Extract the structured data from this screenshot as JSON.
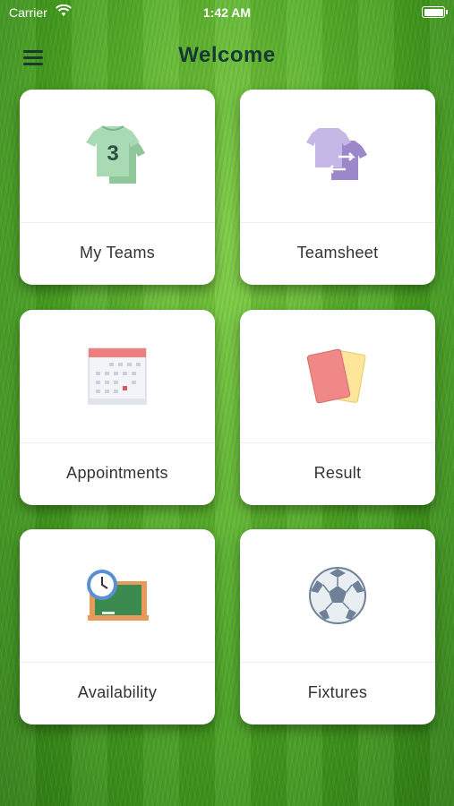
{
  "status_bar": {
    "carrier": "Carrier",
    "time": "1:42 AM"
  },
  "nav": {
    "title": "Welcome"
  },
  "tiles": [
    {
      "label": "My Teams",
      "icon": "jersey-icon",
      "jersey_number": "3"
    },
    {
      "label": "Teamsheet",
      "icon": "swap-jerseys-icon"
    },
    {
      "label": "Appointments",
      "icon": "calendar-icon"
    },
    {
      "label": "Result",
      "icon": "cards-icon"
    },
    {
      "label": "Availability",
      "icon": "clock-board-icon"
    },
    {
      "label": "Fixtures",
      "icon": "soccer-ball-icon"
    }
  ],
  "colors": {
    "title": "#163a33",
    "background": "#4aa522"
  }
}
